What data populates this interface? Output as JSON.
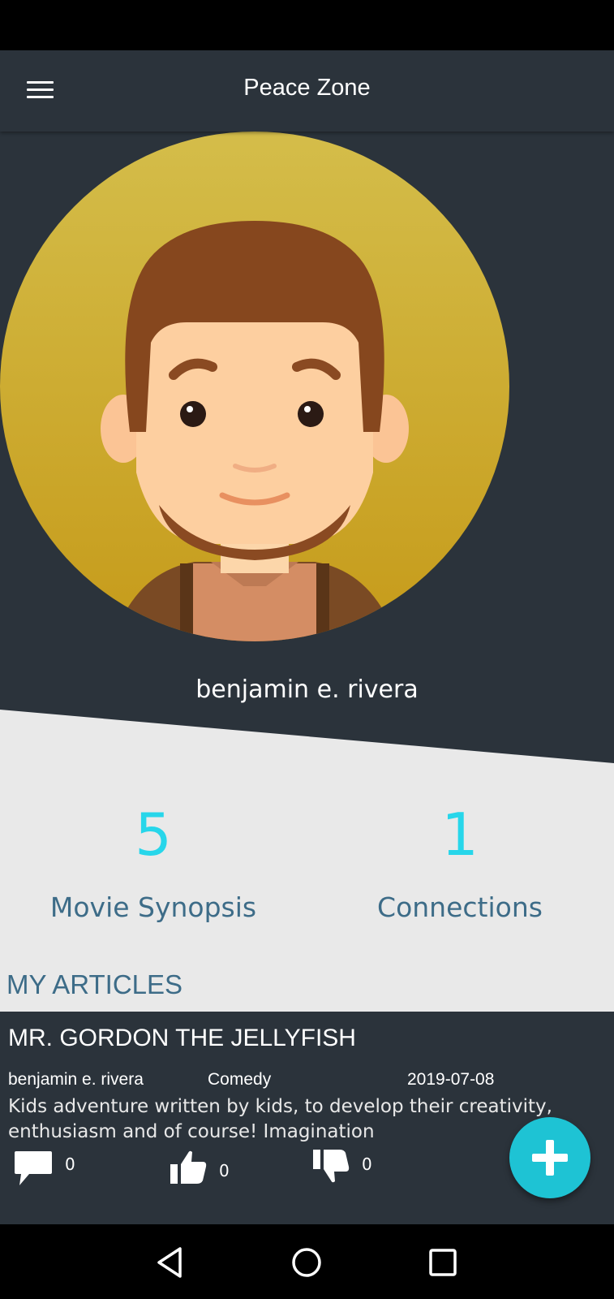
{
  "app": {
    "title": "Peace Zone",
    "colors": {
      "appbar": "#2b333b",
      "accent": "#27d6ea",
      "label": "#3d6c88",
      "fab": "#1ec3d4",
      "background": "#e9e9e9"
    }
  },
  "profile": {
    "username": "benjamin e. rivera",
    "avatar_icon": "male-avatar-illustration"
  },
  "stats": [
    {
      "value": "5",
      "label": "Movie Synopsis"
    },
    {
      "value": "1",
      "label": "Connections"
    }
  ],
  "section": {
    "title": "MY ARTICLES"
  },
  "article": {
    "title": "MR. GORDON THE JELLYFISH",
    "author": "benjamin e. rivera",
    "genre": "Comedy",
    "date": "2019-07-08",
    "description": "Kids adventure written by kids, to develop their creativity, enthusiasm and of course! Imagination",
    "comments": "0",
    "likes": "0",
    "dislikes": "0"
  },
  "icons": {
    "menu": "hamburger-menu-icon",
    "comment": "comment-icon",
    "like": "thumbs-up-icon",
    "dislike": "thumbs-down-icon",
    "fab": "plus-icon",
    "nav_back": "back-triangle-icon",
    "nav_home": "home-circle-icon",
    "nav_recents": "recents-square-icon"
  }
}
